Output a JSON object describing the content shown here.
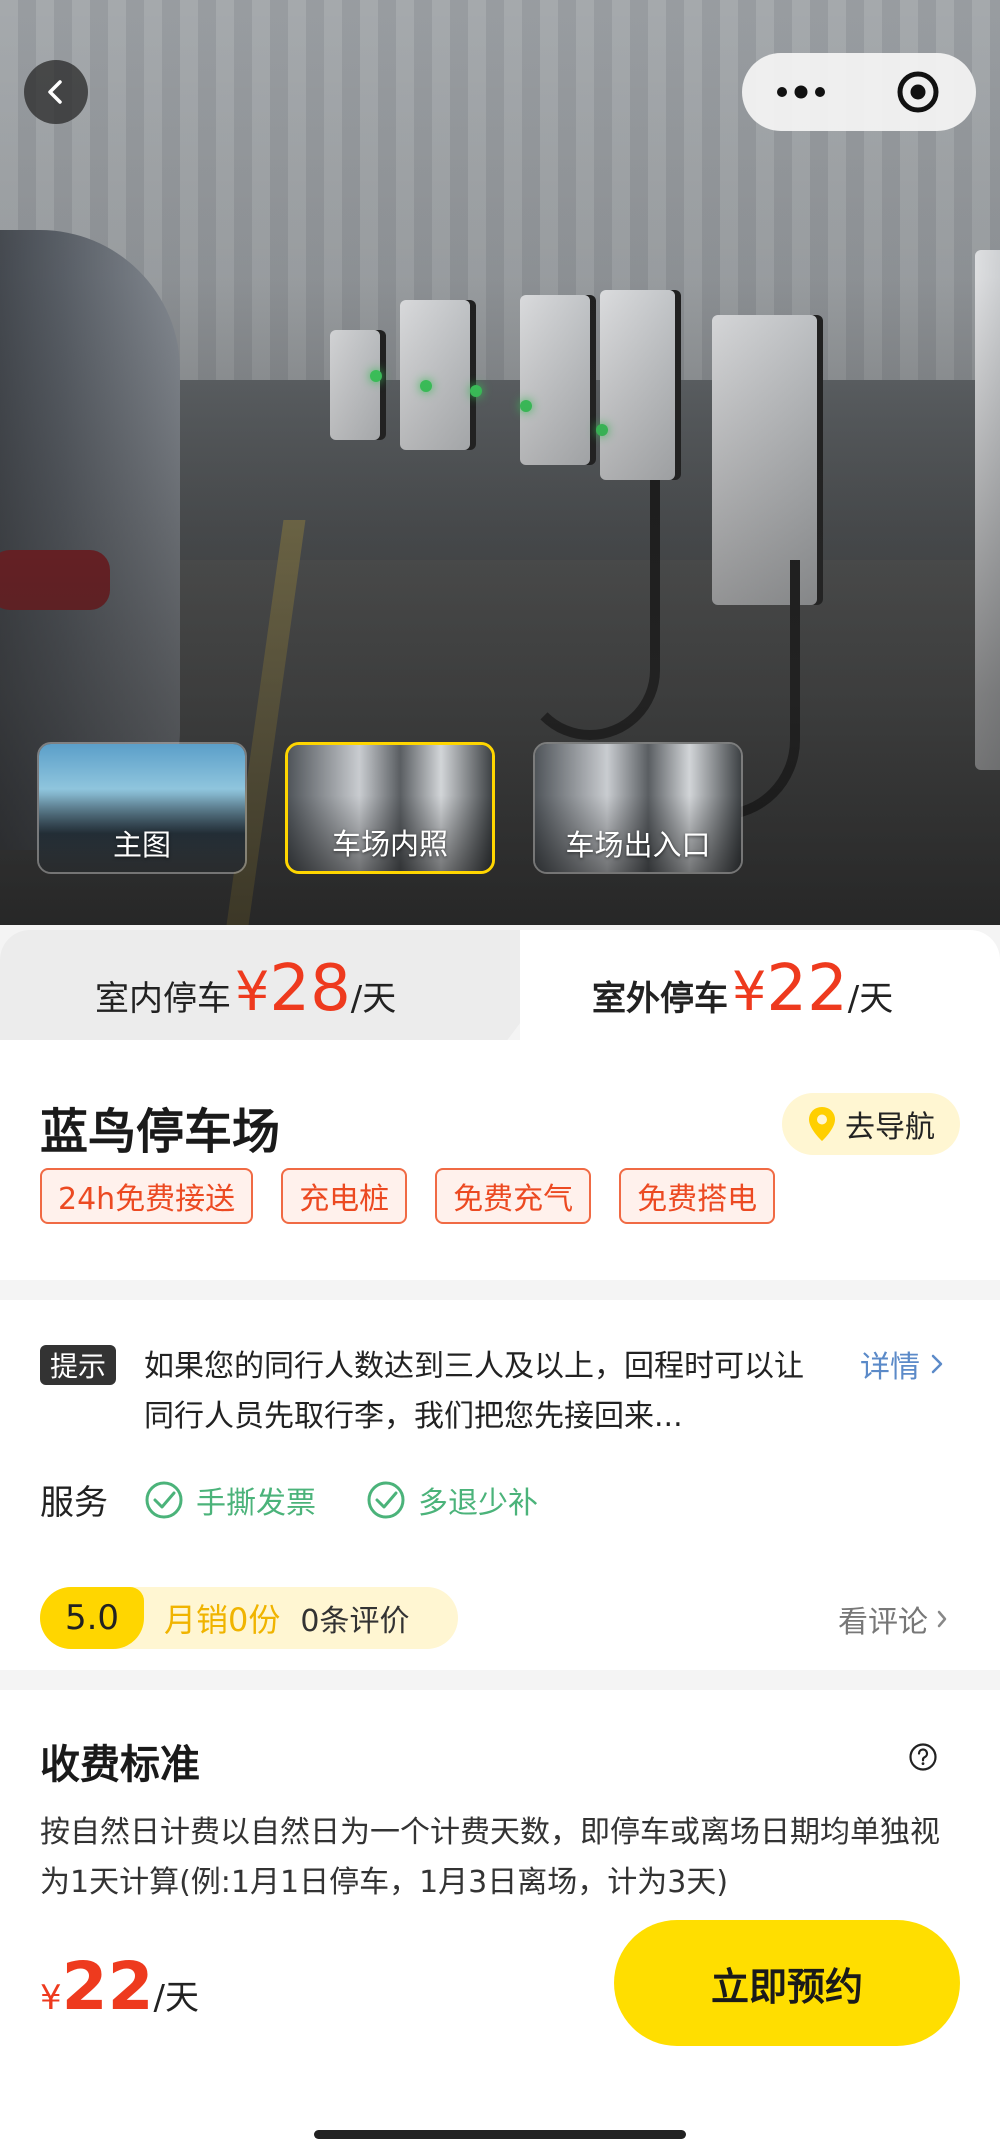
{
  "hero": {
    "thumbnails": [
      {
        "label": "主图"
      },
      {
        "label": "车场内照"
      },
      {
        "label": "车场出入口"
      }
    ]
  },
  "price_tabs": {
    "indoor": {
      "label": "室内停车",
      "currency": "¥",
      "price": "28",
      "unit": "/天"
    },
    "outdoor": {
      "label": "室外停车",
      "currency": "¥",
      "price": "22",
      "unit": "/天"
    }
  },
  "lot": {
    "name": "蓝鸟停车场",
    "navigate_label": "去导航",
    "tags": [
      "24h免费接送",
      "充电桩",
      "免费充气",
      "免费搭电"
    ]
  },
  "tip": {
    "badge": "提示",
    "text": "如果您的同行人数达到三人及以上，回程时可以让同行人员先取行李，我们把您先接回来...",
    "detail_label": "详情"
  },
  "services": {
    "label": "服务",
    "items": [
      "手撕发票",
      "多退少补"
    ]
  },
  "rating": {
    "score": "5.0",
    "sales": "月销0份",
    "reviews": "0条评价",
    "see_reviews": "看评论"
  },
  "fee": {
    "title": "收费标准",
    "text": "按自然日计费以自然日为一个计费天数，即停车或离场日期均单独视为1天计算(例:1月1日停车，1月3日离场，计为3天)"
  },
  "bottom": {
    "currency": "¥",
    "price": "22",
    "unit": "/天",
    "book_label": "立即预约"
  },
  "colors": {
    "price_red": "#ee3a1e",
    "accent_yellow": "#ffde00",
    "service_green": "#4bb37a",
    "link_blue": "#5b8ac8"
  }
}
